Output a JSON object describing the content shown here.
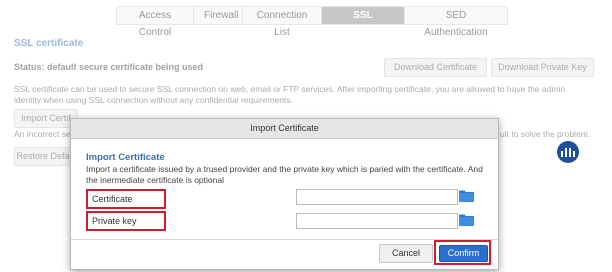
{
  "tabs": [
    "Access Control",
    "Firewall",
    "Connection List",
    "SSL Certificate",
    "SED Authentication"
  ],
  "active_tab": "SSL Certificate",
  "page": {
    "section_title": "SSL certificate",
    "status": "Status: default secure certificate being used",
    "download_certificate": "Download Certificate",
    "download_private_key": "Download Private Key",
    "description": "SSL certificate can be used to secure SSL connection on web, email or FTP services. After importing certificate, you are allowed to have the admin identity when using SSL connection without any confidential requirements.",
    "import_certificate": "Import Certif",
    "error_text": "An incorrect se",
    "error_tail": "ult to solve the problem.",
    "restore_default": "Restore Defa"
  },
  "modal": {
    "header": "Import Certificate",
    "title": "Import Certificate",
    "description": "Import a certificate issued by a trused provider and the private key which is paried with the certificate. And the inermediate certificate is optional",
    "certificate_label": "Certificate",
    "private_key_label": "Private key",
    "certificate_value": "",
    "private_key_value": "",
    "cancel": "Cancel",
    "confirm": "Confirm"
  },
  "colors": {
    "accent": "#2a6fd0",
    "highlight": "#cc1f2d",
    "title_blue": "#3a6fb5",
    "folder": "#2b7bd4"
  },
  "icons": {
    "folder": "folder-icon",
    "brand": "brand-logo-icon"
  }
}
